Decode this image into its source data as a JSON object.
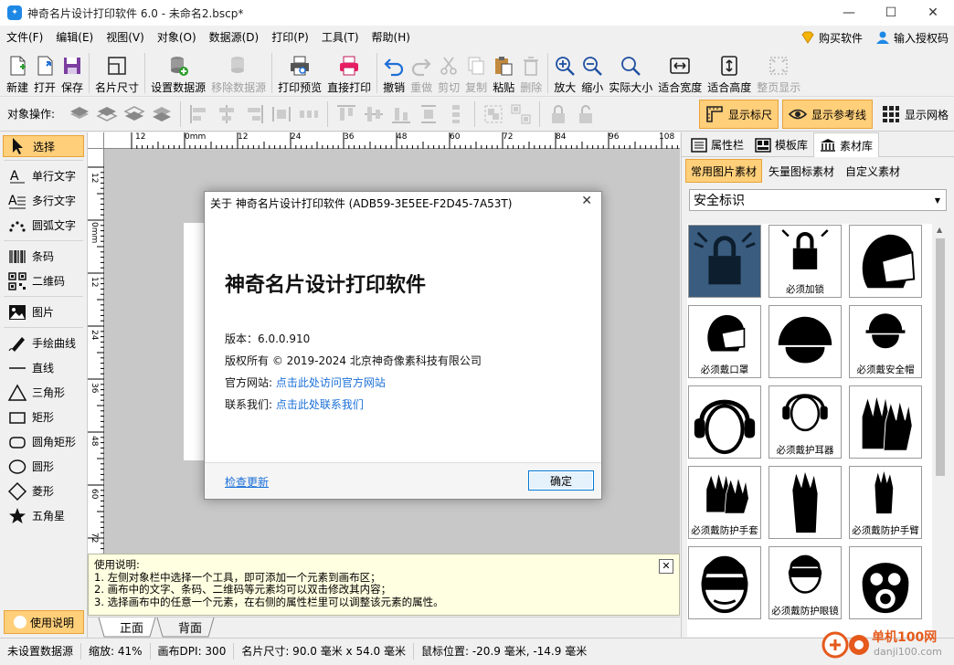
{
  "window": {
    "title": "神奇名片设计打印软件 6.0 - 未命名2.bscp*",
    "controls": [
      "—",
      "☐",
      "✕"
    ]
  },
  "menu": {
    "items": [
      "文件(F)",
      "编辑(E)",
      "视图(V)",
      "对象(O)",
      "数据源(D)",
      "打印(P)",
      "工具(T)",
      "帮助(H)"
    ],
    "buy": "购买软件",
    "license": "输入授权码"
  },
  "toolbar": {
    "items": [
      {
        "label": "新建",
        "disabled": false
      },
      {
        "label": "打开",
        "disabled": false
      },
      {
        "label": "保存",
        "disabled": false
      },
      {
        "label": "名片尺寸",
        "disabled": false
      },
      {
        "label": "设置数据源",
        "disabled": false
      },
      {
        "label": "移除数据源",
        "disabled": true
      },
      {
        "label": "打印预览",
        "disabled": false
      },
      {
        "label": "直接打印",
        "disabled": false
      },
      {
        "label": "撤销",
        "disabled": false
      },
      {
        "label": "重做",
        "disabled": true
      },
      {
        "label": "剪切",
        "disabled": true
      },
      {
        "label": "复制",
        "disabled": true
      },
      {
        "label": "粘贴",
        "disabled": false
      },
      {
        "label": "删除",
        "disabled": true
      },
      {
        "label": "放大",
        "disabled": false
      },
      {
        "label": "缩小",
        "disabled": false
      },
      {
        "label": "实际大小",
        "disabled": false
      },
      {
        "label": "适合宽度",
        "disabled": false
      },
      {
        "label": "适合高度",
        "disabled": false
      },
      {
        "label": "整页显示",
        "disabled": true
      }
    ]
  },
  "toolbar2": {
    "label": "对象操作:",
    "show_ruler": "显示标尺",
    "show_guides": "显示参考线",
    "show_grid": "显示网格"
  },
  "tools": {
    "select": "选择",
    "items": [
      "单行文字",
      "多行文字",
      "圆弧文字",
      "条码",
      "二维码",
      "图片",
      "手绘曲线",
      "直线",
      "三角形",
      "矩形",
      "圆角矩形",
      "圆形",
      "菱形",
      "五角星"
    ],
    "help": "使用说明"
  },
  "ruler": {
    "top": [
      "12",
      "0mm",
      "12",
      "24",
      "36",
      "48",
      "60",
      "72",
      "84",
      "96",
      "108"
    ],
    "left": [
      "12",
      "0mm",
      "12",
      "24",
      "36",
      "48",
      "60",
      "72",
      "84"
    ]
  },
  "dialog": {
    "title": "关于 神奇名片设计打印软件 (ADB59-3E5EE-F2D45-7A53T)",
    "product": "神奇名片设计打印软件",
    "version_label": "版本：6.0.0.910",
    "copyright": "版权所有 © 2019-2024 北京神奇像素科技有限公司",
    "site_label": "官方网站:",
    "site_link": "点击此处访问官方网站",
    "contact_label": "联系我们:",
    "contact_link": "点击此处联系我们",
    "check_update": "检查更新",
    "ok": "确定"
  },
  "help_box": {
    "title": "使用说明:",
    "lines": [
      "1. 左侧对象栏中选择一个工具，即可添加一个元素到画布区；",
      "2. 画布中的文字、条码、二维码等元素均可以双击修改其内容；",
      "3. 选择画布中的任意一个元素，在右侧的属性栏里可以调整该元素的属性。"
    ]
  },
  "page_tabs": [
    "正面",
    "背面"
  ],
  "right_panel": {
    "tabs": [
      "属性栏",
      "模板库",
      "素材库"
    ],
    "subtabs": [
      "常用图片素材",
      "矢量图标素材",
      "自定义素材"
    ],
    "category": "安全标识",
    "items": [
      {
        "label": "",
        "icon": "lock-sign-icon"
      },
      {
        "label": "必须加锁",
        "icon": "padlock-icon"
      },
      {
        "label": "",
        "icon": "dust-mask-icon"
      },
      {
        "label": "必须戴口罩",
        "icon": "mask-head-icon"
      },
      {
        "label": "",
        "icon": "helmet-icon"
      },
      {
        "label": "必须戴安全帽",
        "icon": "safety-helmet-icon"
      },
      {
        "label": "",
        "icon": "ear-muff-head-icon"
      },
      {
        "label": "必须戴护耳器",
        "icon": "ear-protector-icon"
      },
      {
        "label": "",
        "icon": "gloves-icon"
      },
      {
        "label": "必须戴防护手套",
        "icon": "protective-glove-icon"
      },
      {
        "label": "",
        "icon": "long-glove-icon"
      },
      {
        "label": "必须戴防护手臂",
        "icon": "arm-glove-icon"
      },
      {
        "label": "",
        "icon": "goggles-head-icon"
      },
      {
        "label": "必须戴防护眼镜",
        "icon": "goggles-icon"
      },
      {
        "label": "",
        "icon": "gas-mask-icon"
      }
    ]
  },
  "status": {
    "datasource": "未设置数据源",
    "zoom": "缩放: 41%",
    "dpi": "画布DPI: 300",
    "size": "名片尺寸: 90.0 毫米 x 54.0 毫米",
    "mouse": "鼠标位置: -20.9 毫米, -14.9 毫米"
  },
  "watermark": {
    "text1": "单机100网",
    "text2": "danji100.com"
  },
  "colors": {
    "accent": "#ffcf7a",
    "accent_border": "#e8a33a",
    "link": "#1a6fd8",
    "selected_tile": "#3a5c7e"
  }
}
